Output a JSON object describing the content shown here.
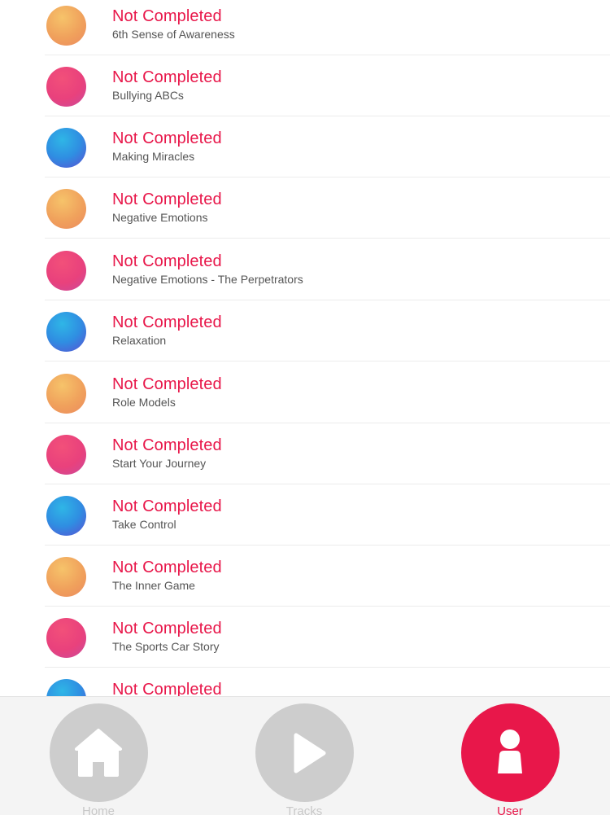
{
  "list": {
    "status_label": "Not Completed",
    "items": [
      {
        "title": "6th Sense of Awareness",
        "status": "Not Completed",
        "thumb_color": "orange"
      },
      {
        "title": "Bullying ABCs",
        "status": "Not Completed",
        "thumb_color": "pink"
      },
      {
        "title": "Making Miracles",
        "status": "Not Completed",
        "thumb_color": "blue"
      },
      {
        "title": "Negative Emotions",
        "status": "Not Completed",
        "thumb_color": "orange"
      },
      {
        "title": "Negative Emotions - The Perpetrators",
        "status": "Not Completed",
        "thumb_color": "pink"
      },
      {
        "title": "Relaxation",
        "status": "Not Completed",
        "thumb_color": "blue"
      },
      {
        "title": "Role Models",
        "status": "Not Completed",
        "thumb_color": "orange"
      },
      {
        "title": "Start Your Journey",
        "status": "Not Completed",
        "thumb_color": "pink"
      },
      {
        "title": "Take Control",
        "status": "Not Completed",
        "thumb_color": "blue"
      },
      {
        "title": "The Inner Game",
        "status": "Not Completed",
        "thumb_color": "orange"
      },
      {
        "title": "The Sports Car Story",
        "status": "Not Completed",
        "thumb_color": "pink"
      },
      {
        "title": "",
        "status": "Not Completed",
        "thumb_color": "blue"
      }
    ]
  },
  "tabbar": {
    "home": {
      "label": "Home",
      "icon": "home-icon"
    },
    "tracks": {
      "label": "Tracks",
      "icon": "play-icon"
    },
    "user": {
      "label": "User",
      "icon": "user-icon"
    }
  },
  "colors": {
    "accent": "#e8174a",
    "inactive_tab": "#cdcdcd",
    "title_text": "#555555"
  }
}
